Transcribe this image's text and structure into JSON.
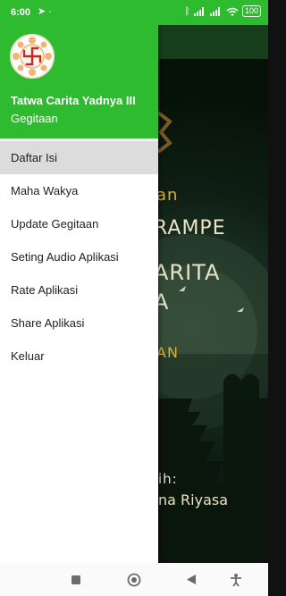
{
  "status_bar": {
    "time": "6:00",
    "battery": "100"
  },
  "drawer": {
    "header": {
      "title": "Tatwa Carita Yadnya III",
      "subtitle": "Gegitaan"
    },
    "items": [
      {
        "label": "Daftar Isi",
        "active": true
      },
      {
        "label": "Maha Wakya",
        "active": false
      },
      {
        "label": "Update Gegitaan",
        "active": false
      },
      {
        "label": "Seting Audio Aplikasi",
        "active": false
      },
      {
        "label": "Rate Aplikasi",
        "active": false
      },
      {
        "label": "Share Aplikasi",
        "active": false
      },
      {
        "label": "Keluar",
        "active": false
      }
    ]
  },
  "background": {
    "subtitle": "an",
    "line1": "RAMPE",
    "line2": "ARITA",
    "line3": "A",
    "line4": "AN",
    "by": "ih:",
    "author": "na Riyasa"
  },
  "colors": {
    "accent": "#2fbb2f",
    "active_item": "#dcdcdc",
    "gold": "#d9b02a"
  },
  "icons": {
    "logo": "swastika-logo-icon",
    "nav": [
      "recents-square-icon",
      "home-circle-icon",
      "back-triangle-icon",
      "accessibility-icon"
    ]
  }
}
